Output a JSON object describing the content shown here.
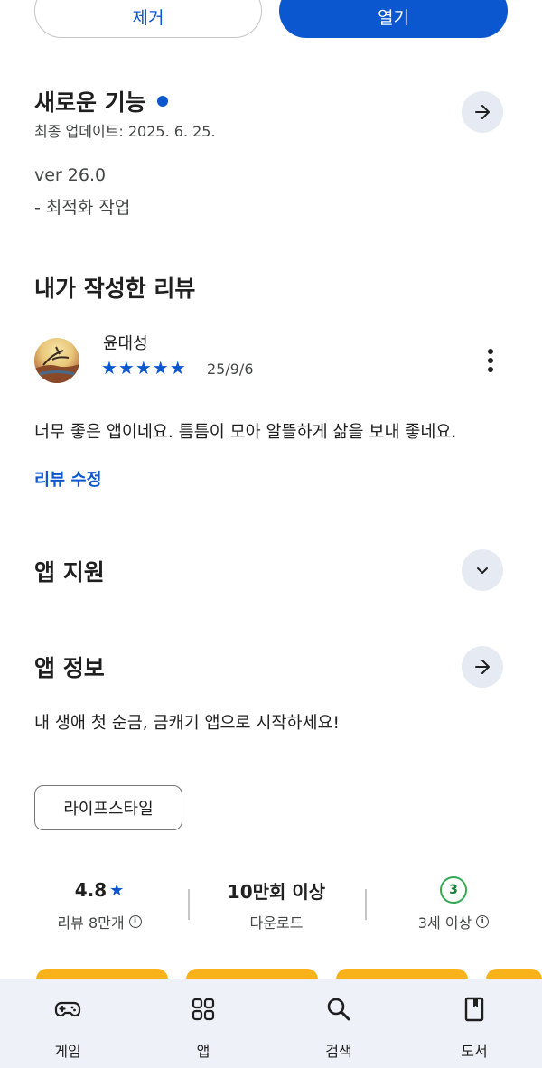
{
  "actions": {
    "remove_label": "제거",
    "open_label": "열기"
  },
  "whats_new": {
    "title": "새로운 기능",
    "last_updated": "최종 업데이트: 2025. 6. 25.",
    "version": "ver 26.0",
    "notes": "- 최적화 작업"
  },
  "my_review": {
    "title": "내가 작성한 리뷰",
    "reviewer": "윤대성",
    "stars": "★★★★★",
    "rating": 5,
    "date": "25/9/6",
    "text": "너무 좋은 앱이네요. 틈틈이 모아 알뜰하게 삶을 보내 좋네요.",
    "edit_label": "리뷰 수정"
  },
  "app_support": {
    "title": "앱 지원"
  },
  "app_info": {
    "title": "앱 정보",
    "description": "내 생애 첫 순금, 금캐기 앱으로 시작하세요!",
    "category": "라이프스타일"
  },
  "stats": {
    "rating_value": "4.8",
    "reviews_label": "리뷰 8만개",
    "downloads_value": "10만회 이상",
    "downloads_label": "다운로드",
    "age_badge": "3",
    "age_label": "3세 이상"
  },
  "bottom_nav": [
    {
      "label": "게임",
      "icon": "gamepad-icon"
    },
    {
      "label": "앱",
      "icon": "apps-grid-icon"
    },
    {
      "label": "검색",
      "icon": "search-icon"
    },
    {
      "label": "도서",
      "icon": "book-icon"
    }
  ],
  "colors": {
    "accent": "#0b57d0",
    "nav_bg": "#eef2f8",
    "age_green": "#34a853",
    "screenshot_gold": "#f9b21a"
  }
}
